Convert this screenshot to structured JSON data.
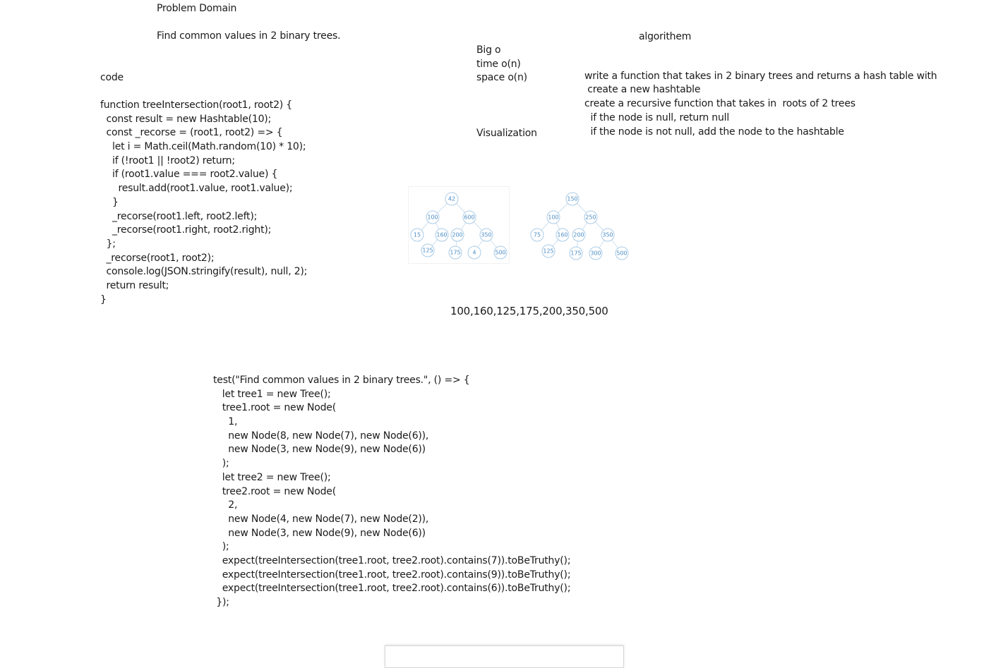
{
  "problem": {
    "heading": "Problem Domain",
    "statement": "Find common values in 2 binary trees."
  },
  "algorithm": {
    "heading": "algorithem",
    "steps": [
      "write a function that takes in 2 binary trees and returns a hash table with",
      " create a new hashtable",
      "create a recursive function that takes in  roots of 2 trees",
      "  if the node is null, return null",
      "  if the node is not null, add the node to the hashtable"
    ]
  },
  "big_o": {
    "heading": "Big o",
    "time": "time o(n)",
    "space": "space o(n)"
  },
  "visualization": {
    "heading": "Visualization",
    "result": "100,160,125,175,200,350,500",
    "tree1_labels": [
      "42",
      "100",
      "600",
      "15",
      "160",
      "200",
      "350",
      "125",
      "175",
      "4",
      "500"
    ],
    "tree2_labels": [
      "150",
      "100",
      "250",
      "75",
      "160",
      "200",
      "350",
      "125",
      "175",
      "300",
      "500"
    ]
  },
  "code": {
    "heading": "code",
    "lines": [
      "function treeIntersection(root1, root2) {",
      "  const result = new Hashtable(10);",
      "  const _recorse = (root1, root2) => {",
      "    let i = Math.ceil(Math.random(10) * 10);",
      "    if (!root1 || !root2) return;",
      "    if (root1.value === root2.value) {",
      "      result.add(root1.value, root1.value);",
      "    }",
      "    _recorse(root1.left, root2.left);",
      "    _recorse(root1.right, root2.right);",
      "  };",
      "  _recorse(root1, root2);",
      "  console.log(JSON.stringify(result), null, 2);",
      "  return result;",
      "}"
    ]
  },
  "test": {
    "lines": [
      "test(\"Find common values in 2 binary trees.\", () => {",
      "   let tree1 = new Tree();",
      "   tree1.root = new Node(",
      "     1,",
      "     new Node(8, new Node(7), new Node(6)),",
      "     new Node(3, new Node(9), new Node(6))",
      "   );",
      "   let tree2 = new Tree();",
      "   tree2.root = new Node(",
      "     2,",
      "     new Node(4, new Node(7), new Node(2)),",
      "     new Node(3, new Node(9), new Node(6))",
      "   );",
      "   expect(treeIntersection(tree1.root, tree2.root).contains(7)).toBeTruthy();",
      "   expect(treeIntersection(tree1.root, tree2.root).contains(9)).toBeTruthy();",
      "   expect(treeIntersection(tree1.root, tree2.root).contains(6)).toBeTruthy();",
      " });"
    ]
  }
}
